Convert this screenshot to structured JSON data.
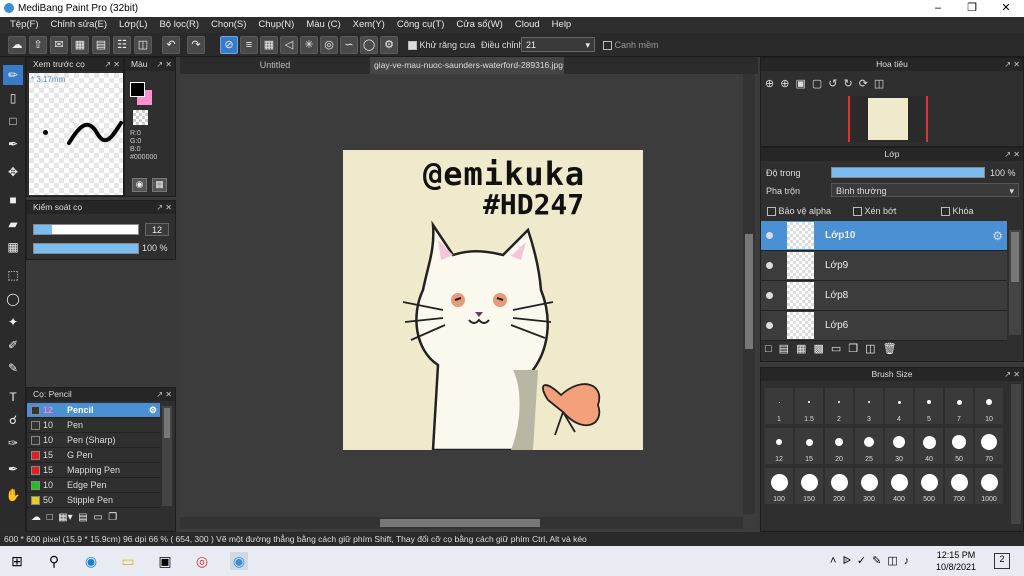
{
  "window": {
    "title": "MediBang Paint Pro (32bit)"
  },
  "menu": [
    "Tệp(F)",
    "Chỉnh sửa(E)",
    "Lớp(L)",
    "Bộ lọc(R)",
    "Chọn(S)",
    "Chụp(N)",
    "Màu (C)",
    "Xem(Y)",
    "Công cụ(T)",
    "Cửa sổ(W)",
    "Cloud",
    "Help"
  ],
  "toolbar": {
    "antialias_label": "Khử răng cưa",
    "adjust_label": "Điều chỉnh",
    "adjust_value": "21",
    "snap_label": "Canh mềm"
  },
  "preview": {
    "title": "Xem trước cọ",
    "size_label": "* 3.17mm"
  },
  "color": {
    "title": "Màu",
    "r": "R:0",
    "g": "G:0",
    "b": "B:0",
    "hex": "#000000",
    "fg": "#000000",
    "bg": "#ff8fd0"
  },
  "brush_control": {
    "title": "Kiểm soát cọ",
    "size": "12",
    "opacity": "100 %",
    "size_frac": 0.17,
    "opacity_frac": 1.0
  },
  "brush_list": {
    "title": "Cọ: Pencil",
    "items": [
      {
        "size": "12",
        "name": "Pencil",
        "color": "#333333",
        "selected": true
      },
      {
        "size": "10",
        "name": "Pen",
        "color": "#333333"
      },
      {
        "size": "10",
        "name": "Pen (Sharp)",
        "color": "#333333"
      },
      {
        "size": "15",
        "name": "G Pen",
        "color": "#e02020"
      },
      {
        "size": "15",
        "name": "Mapping Pen",
        "color": "#e02020"
      },
      {
        "size": "10",
        "name": "Edge Pen",
        "color": "#20c020"
      },
      {
        "size": "50",
        "name": "Stipple Pen",
        "color": "#e0d020"
      }
    ]
  },
  "tabs": {
    "untitled": "Untitled",
    "file": "giay-ve-mau-nuoc-saunders-waterford-289316.jpg"
  },
  "canvas_text": {
    "handle": "@emikuka",
    "tag": "#HD247"
  },
  "navigator": {
    "title": "Hoa tiêu"
  },
  "layers": {
    "title": "Lớp",
    "opacity_label": "Độ trong",
    "opacity_value": "100 %",
    "blend_label": "Pha trộn",
    "blend_value": "Bình thường",
    "protect_alpha": "Bảo vệ alpha",
    "clipping": "Xén bớt",
    "lock": "Khóa",
    "items": [
      {
        "name": "Lớp10",
        "selected": true
      },
      {
        "name": "Lớp9"
      },
      {
        "name": "Lớp8"
      },
      {
        "name": "Lớp6"
      }
    ]
  },
  "brush_size": {
    "title": "Brush Size",
    "sizes": [
      "1",
      "1.5",
      "2",
      "3",
      "4",
      "5",
      "7",
      "10",
      "12",
      "15",
      "20",
      "25",
      "30",
      "40",
      "50",
      "70",
      "100",
      "150",
      "200",
      "300",
      "400",
      "500",
      "700",
      "1000"
    ]
  },
  "status": "600 * 600 pixel  (15.9 * 15.9cm)  96 dpi  66 %  ( 654, 300 )  Vẽ một đường thẳng bằng cách giữ phím Shift, Thay đổi cỡ cọ bằng cách giữ phím Ctrl, Alt và kéo",
  "taskbar": {
    "time": "12:15 PM",
    "date": "10/8/2021",
    "notif": "2"
  }
}
